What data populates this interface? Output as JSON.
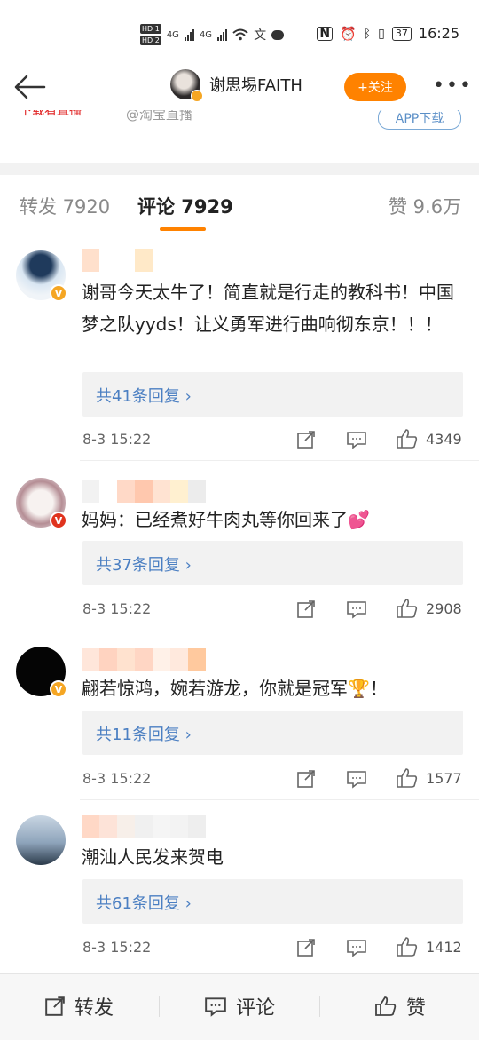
{
  "status": {
    "hd1": "HD 1",
    "hd2": "HD 2",
    "net1": "4G",
    "net2": "4G",
    "battery": "37",
    "time": "16:25"
  },
  "nav": {
    "username": "谢思埸FAITH",
    "follow_label": "+关注",
    "more_label": "•••"
  },
  "peek": {
    "red_text": "下载看直播",
    "source_text": "@淘宝直播",
    "app_button": "APP下载"
  },
  "tabs": [
    {
      "label": "转发 7920"
    },
    {
      "label": "评论 7929"
    },
    {
      "label": "赞 9.6万"
    }
  ],
  "comments": [
    {
      "text": "谢哥今天太牛了！简直就是行走的教科书！中国梦之队yyds！让义勇军进行曲响彻东京！！！",
      "replies": "共41条回复",
      "date": "8-3 15:22",
      "likes": "4349",
      "badge_color": "#f5a623",
      "name_colors": [
        "#ffe0cc",
        "#ffffff",
        "#ffffff",
        "#ffe9c8"
      ]
    },
    {
      "text": "妈妈：已经煮好牛肉丸等你回来了💕",
      "replies": "共37条回复",
      "date": "8-3 15:22",
      "likes": "2908",
      "badge_color": "#e0331e",
      "name_colors": [
        "#f2f2f2",
        "#ffffff",
        "#ffd9c7",
        "#ffc8ae",
        "#ffe3d2",
        "#fff0d0",
        "#ececec"
      ]
    },
    {
      "text": "翩若惊鸿，婉若游龙，你就是冠军🏆！",
      "replies": "共11条回复",
      "date": "8-3 15:22",
      "likes": "1577",
      "badge_color": "#f5a623",
      "name_colors": [
        "#ffe6da",
        "#ffd3c0",
        "#ffe2cf",
        "#ffd6c4",
        "#fff1e8",
        "#ffe9dd",
        "#ffc99e"
      ]
    },
    {
      "text": "潮汕人民发来贺电",
      "replies": "共61条回复",
      "date": "8-3 15:22",
      "likes": "1412",
      "badge_color": "#f5a623",
      "name_colors": [
        "#ffd8c6",
        "#fde3d8",
        "#f7efe9",
        "#f0f0f0",
        "#f5f5f5",
        "#f3f3f3",
        "#eeeeee"
      ]
    }
  ],
  "bottom": {
    "repost": "转发",
    "comment": "评论",
    "like": "赞"
  }
}
